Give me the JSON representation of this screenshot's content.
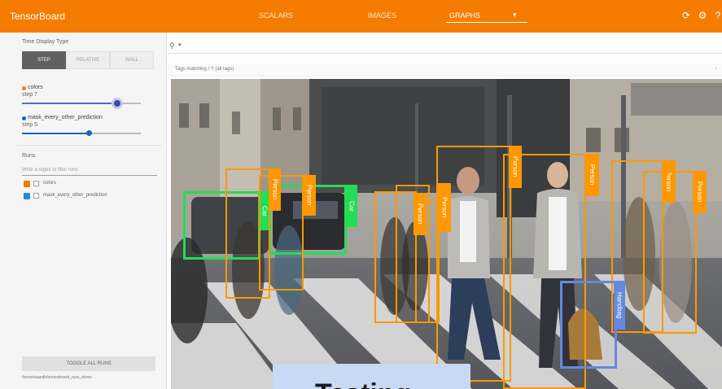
{
  "topbar": {
    "brand": "TensorBoard",
    "nav": [
      "SCALARS",
      "IMAGES",
      "GRAPHS"
    ],
    "active_nav_index": 2,
    "icons": [
      "refresh-icon",
      "settings-icon",
      "help-icon"
    ]
  },
  "sidebar": {
    "time_display_title": "Time Display Type",
    "time_display_options": [
      "STEP",
      "RELATIVE",
      "WALL"
    ],
    "time_display_selected": "STEP",
    "tags": [
      {
        "name": "colors",
        "step_label": "step 7",
        "slider_fraction": 0.91,
        "color": "#f57c00"
      },
      {
        "name": "mask_every_other_prediction",
        "step_label": "step 5",
        "slider_fraction": 0.56,
        "color": "#1565c0"
      }
    ],
    "runs_title": "Runs",
    "runs_filter_placeholder": "Write a regex to filter runs",
    "runs": [
      {
        "name": "colors",
        "checked": true,
        "color": "#f57c00"
      },
      {
        "name": "mask_every_other_prediction",
        "checked": true,
        "color": "#1e88e5"
      }
    ],
    "toggle_all_label": "TOGGLE ALL RUNS",
    "footer_path": "/home/wandb/tensorboard_runs_demo"
  },
  "main": {
    "search_icon": "search-icon",
    "search_caret": "▾",
    "tags_filter_text": "Tags matching /.*/ (all tags)"
  },
  "scene": {
    "colors": {
      "person": "#ff9800",
      "car": "#22dd55",
      "handbag": "#6688dd"
    },
    "boxes": [
      {
        "label": "Car",
        "class": "car"
      },
      {
        "label": "Car",
        "class": "car"
      },
      {
        "label": "Person",
        "class": "person"
      },
      {
        "label": "Person",
        "class": "person"
      },
      {
        "label": "Person",
        "class": "person"
      },
      {
        "label": "Person",
        "class": "person"
      },
      {
        "label": "Person",
        "class": "person"
      },
      {
        "label": "Person",
        "class": "person"
      },
      {
        "label": "Person",
        "class": "person"
      },
      {
        "label": "Person",
        "class": "person"
      },
      {
        "label": "Person",
        "class": "person"
      },
      {
        "label": "Handbag",
        "class": "handbag"
      }
    ]
  },
  "tooltip": {
    "text": "Testing"
  }
}
